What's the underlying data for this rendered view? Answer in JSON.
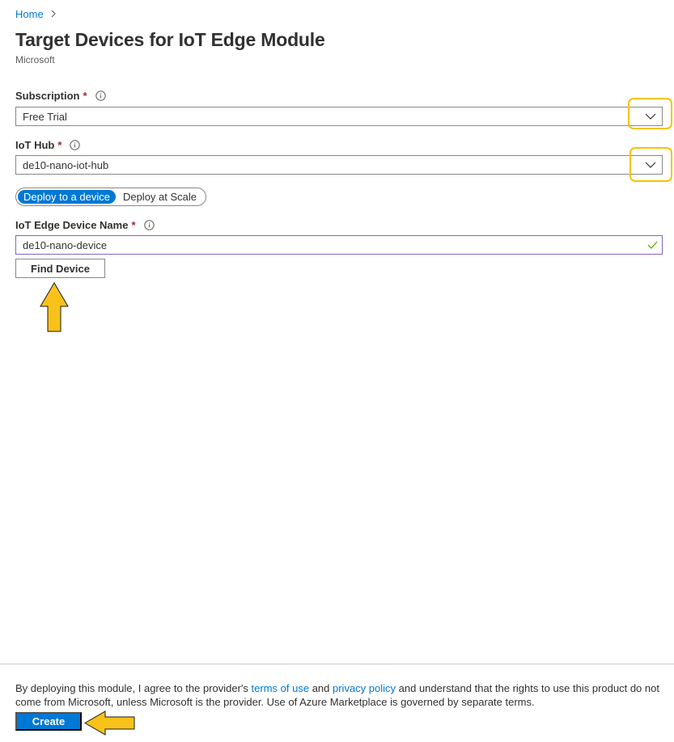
{
  "breadcrumb": {
    "home": "Home"
  },
  "page": {
    "title": "Target Devices for IoT Edge Module",
    "publisher": "Microsoft"
  },
  "subscription": {
    "label": "Subscription",
    "required_mark": "*",
    "value": "Free Trial"
  },
  "iot_hub": {
    "label": "IoT Hub",
    "required_mark": "*",
    "value": "de10-nano-iot-hub"
  },
  "deploy_toggle": {
    "options": [
      "Deploy to a device",
      "Deploy at Scale"
    ],
    "selected": "Deploy to a device"
  },
  "device_name": {
    "label": "IoT Edge Device Name",
    "required_mark": "*",
    "value": "de10-nano-device"
  },
  "find_device": {
    "label": "Find Device"
  },
  "footer": {
    "terms_prefix": "By deploying this module, I agree to the provider's ",
    "terms_link": "terms of use",
    "terms_and": " and ",
    "privacy_link": "privacy policy",
    "terms_suffix": " and understand that the rights to use this product do not come from Microsoft, unless Microsoft is the provider. Use of Azure Marketplace is governed by separate terms.",
    "create_label": "Create"
  },
  "colors": {
    "accent": "#0078d4",
    "highlight": "#f5c400",
    "arrow_fill": "#f8c21a",
    "required": "#a4262c",
    "valid": "#57a300"
  },
  "icons": [
    "chevron-right-icon",
    "info-icon",
    "chevron-down-icon",
    "checkmark-icon",
    "arrow-up-annotation",
    "arrow-left-annotation"
  ]
}
